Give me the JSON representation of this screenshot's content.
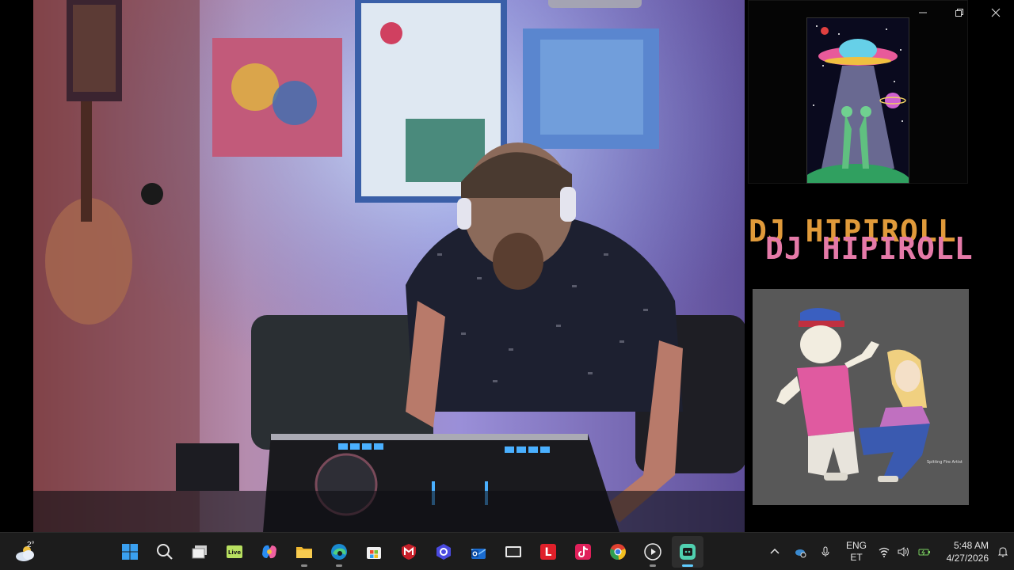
{
  "window": {
    "controls": [
      "minimize",
      "maximize",
      "close"
    ]
  },
  "side_panel": {
    "title_back": "DJ HIPIROLL",
    "title_front": "DJ HIPIROLL",
    "cartoon_signature": "Spitting Fire Artist"
  },
  "taskbar": {
    "weather": {
      "temp": "2°",
      "icon": "cloudy-icon"
    },
    "apps": [
      {
        "name": "start",
        "icon": "windows-logo-icon"
      },
      {
        "name": "search",
        "icon": "search-icon"
      },
      {
        "name": "task-view",
        "icon": "task-view-icon"
      },
      {
        "name": "livestream",
        "icon": "live-app-icon",
        "label": "Live"
      },
      {
        "name": "copilot",
        "icon": "copilot-icon"
      },
      {
        "name": "file-explorer",
        "icon": "folder-icon"
      },
      {
        "name": "edge",
        "icon": "edge-icon"
      },
      {
        "name": "store",
        "icon": "store-icon"
      },
      {
        "name": "mcafee",
        "icon": "mcafee-icon"
      },
      {
        "name": "vpn",
        "icon": "shield-app-icon"
      },
      {
        "name": "mail",
        "icon": "mail-icon"
      },
      {
        "name": "tablet-app",
        "icon": "tablet-icon"
      },
      {
        "name": "l-app",
        "icon": "l-letter-icon",
        "label": "L"
      },
      {
        "name": "tiktok",
        "icon": "tiktok-icon"
      },
      {
        "name": "chrome",
        "icon": "chrome-icon"
      },
      {
        "name": "media-player",
        "icon": "play-icon"
      },
      {
        "name": "streaming-app",
        "icon": "stream-app-icon"
      }
    ],
    "tray": {
      "language_top": "ENG",
      "language_bottom": "ET",
      "time": "5:48 AM",
      "date": "4/27/2026"
    }
  },
  "colors": {
    "taskbar_bg": "#1c1c1c",
    "active_indicator": "#60cdff",
    "title_back": "#e09a3a",
    "title_front": "#e57aa8"
  }
}
